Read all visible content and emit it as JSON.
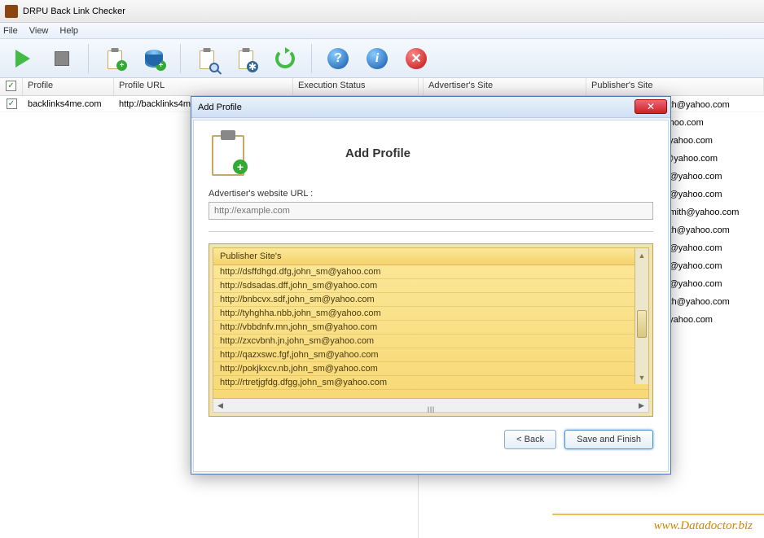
{
  "window": {
    "title": "DRPU Back Link Checker"
  },
  "menu": {
    "file": "File",
    "view": "View",
    "help": "Help"
  },
  "columns": {
    "profile": "Profile",
    "profile_url": "Profile URL",
    "execution_status": "Execution Status",
    "advertisers_site": "Advertiser's Site",
    "publishers_site": "Publisher's Site"
  },
  "row": {
    "profile": "backlinks4me.com",
    "profile_url": "http://backlinks4m"
  },
  "emails": [
    "mith@yahoo.com",
    "yahoo.com",
    "@yahoo.com",
    "n@yahoo.com",
    "ith@yahoo.com",
    "ith@yahoo.com",
    "_smith@yahoo.com",
    "mith@yahoo.com",
    "ith@yahoo.com",
    "ith@yahoo.com",
    "ith@yahoo.com",
    "mith@yahoo.com",
    "@yahoo.com"
  ],
  "modal": {
    "title": "Add Profile",
    "heading": "Add Profile",
    "url_label": "Advertiser's website URL :",
    "url_placeholder": "http://example.com",
    "publisher_header": "Publisher Site's",
    "publishers": [
      "http://dsffdhgd.dfg,john_sm@yahoo.com",
      "http://sdsadas.dff,john_sm@yahoo.com",
      "http://bnbcvx.sdf,john_sm@yahoo.com",
      "http://tyhghha.nbb,john_sm@yahoo.com",
      "http://vbbdnfv.mn,john_sm@yahoo.com",
      "http://zxcvbnh.jn,john_sm@yahoo.com",
      "http://qazxswc.fgf,john_sm@yahoo.com",
      "http://pokjkxcv.nb,john_sm@yahoo.com",
      "http://rtretjgfdg.dfgg,john_sm@yahoo.com"
    ],
    "hscroll_label": "III",
    "back": "< Back",
    "save": "Save and Finish"
  },
  "watermark": "www.Datadoctor.biz"
}
